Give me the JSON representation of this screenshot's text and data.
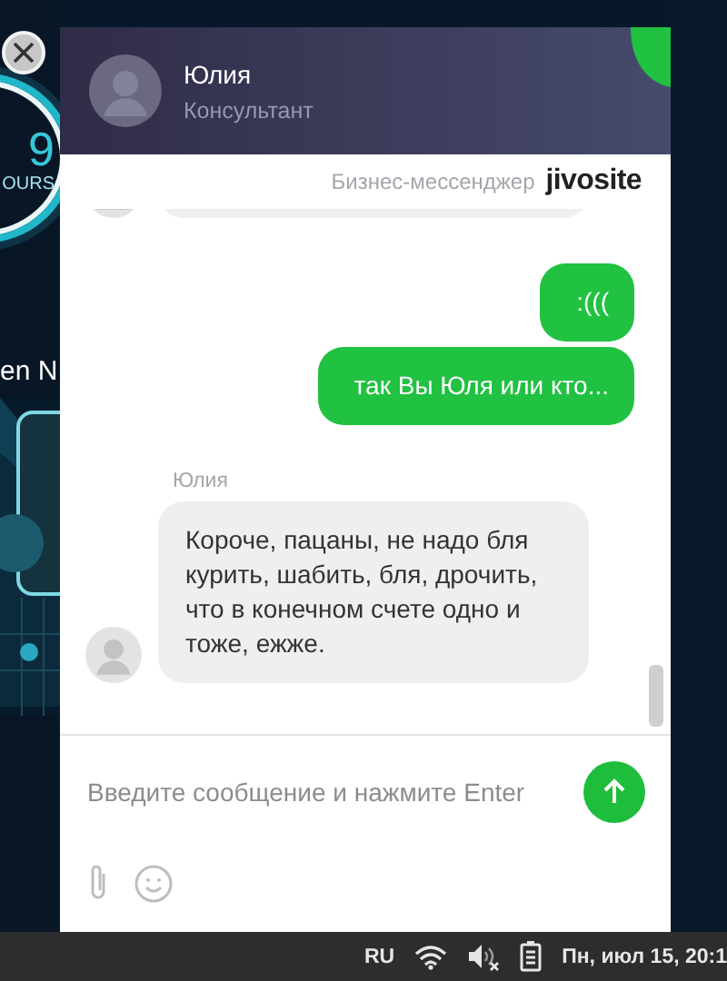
{
  "background_page": {
    "counter": "9",
    "counter_unit": "OURS",
    "heading_fragment": "en N"
  },
  "chat": {
    "operator": {
      "name": "Юлия",
      "role": "Консультант"
    },
    "branding": {
      "tagline": "Бизнес-мессенджер",
      "logo": "jivosite"
    },
    "messages": [
      {
        "kind": "operator"
      },
      {
        "kind": "visitor",
        "text": ":((("
      },
      {
        "kind": "visitor",
        "text": "так Вы Юля или кто..."
      },
      {
        "kind": "operator",
        "sender": "Юлия",
        "text": "Короче, пацаны, не надо бля курить, шабить, бля, дрочить, что в конечном счете одно и тоже, ежже."
      }
    ],
    "composer": {
      "placeholder": "Введите сообщение и нажмите Enter"
    }
  },
  "taskbar": {
    "language": "RU",
    "clock": "Пн, июл 15, 20:1"
  }
}
